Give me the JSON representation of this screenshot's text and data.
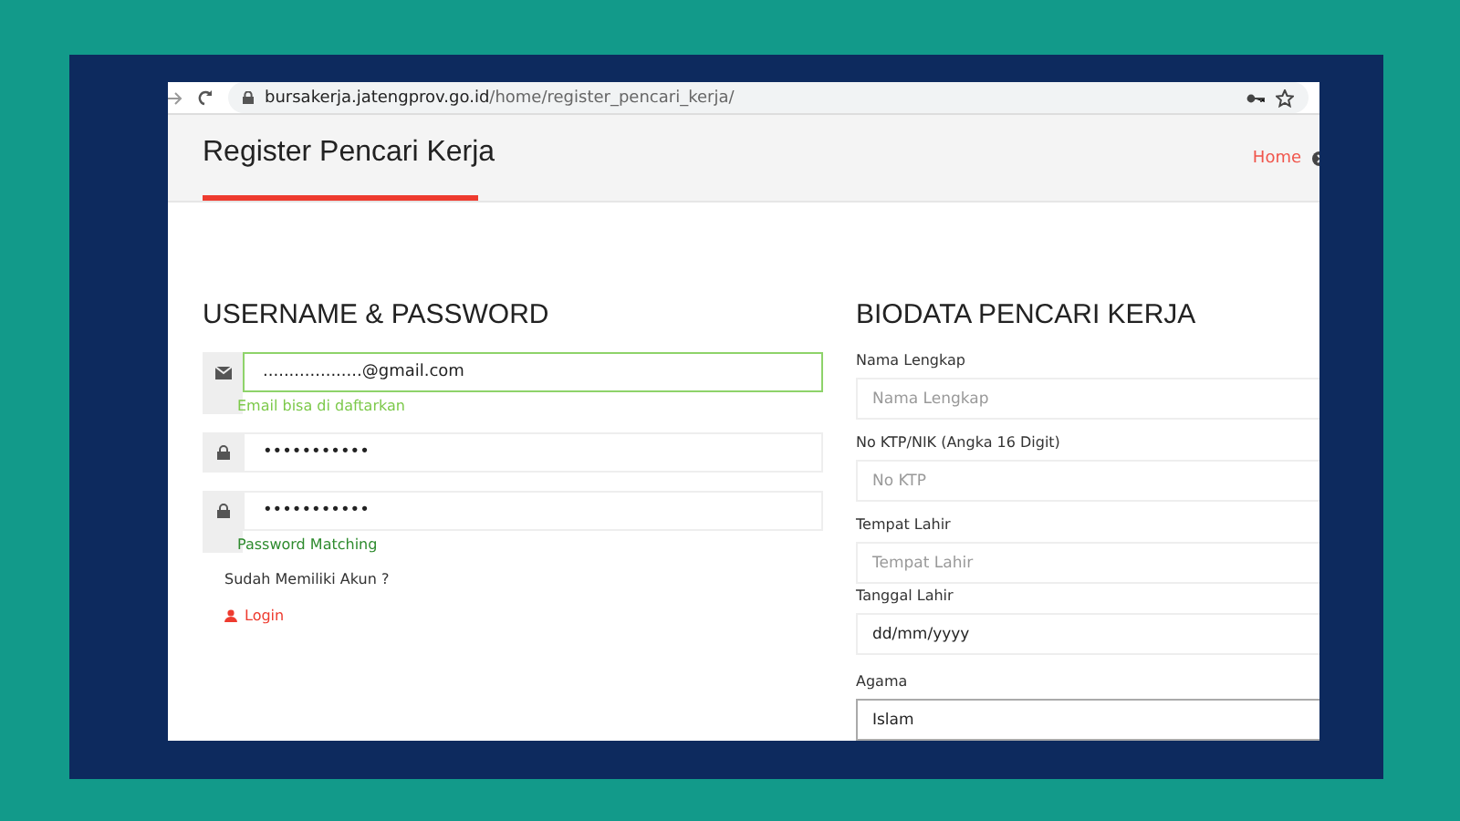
{
  "browser": {
    "url_host": "bursakerja.jatengprov.go.id",
    "url_path": "/home/register_pencari_kerja/"
  },
  "header": {
    "title": "Register Pencari Kerja",
    "breadcrumb": "Home"
  },
  "account": {
    "heading": "USERNAME & PASSWORD",
    "fields": [
      {
        "kind": "email",
        "value": "...................@gmail.com",
        "valid": true,
        "hint": "Email bisa di daftarkan",
        "color": "#7cc94a"
      },
      {
        "kind": "password",
        "value": "•••••••••••",
        "valid": false
      },
      {
        "kind": "password",
        "value": "•••••••••••",
        "valid": false,
        "hint": "Password Matching",
        "color": "#2e8b2e"
      }
    ],
    "login_prompt": "Sudah Memiliki Akun ?",
    "login_link": "Login"
  },
  "biodata": {
    "heading": "BIODATA PENCARI KERJA",
    "fields": [
      {
        "kind": "text",
        "label": "Nama Lengkap",
        "placeholder": "Nama Lengkap"
      },
      {
        "kind": "text",
        "label": "No KTP/NIK (Angka 16 Digit)",
        "placeholder": "No KTP"
      },
      {
        "kind": "text",
        "label": "Tempat Lahir",
        "placeholder": "Tempat Lahir"
      },
      {
        "kind": "date",
        "label": "Tanggal Lahir",
        "value": "dd/mm/yyyy"
      },
      {
        "kind": "select",
        "label": "Agama",
        "value": "Islam"
      }
    ]
  }
}
